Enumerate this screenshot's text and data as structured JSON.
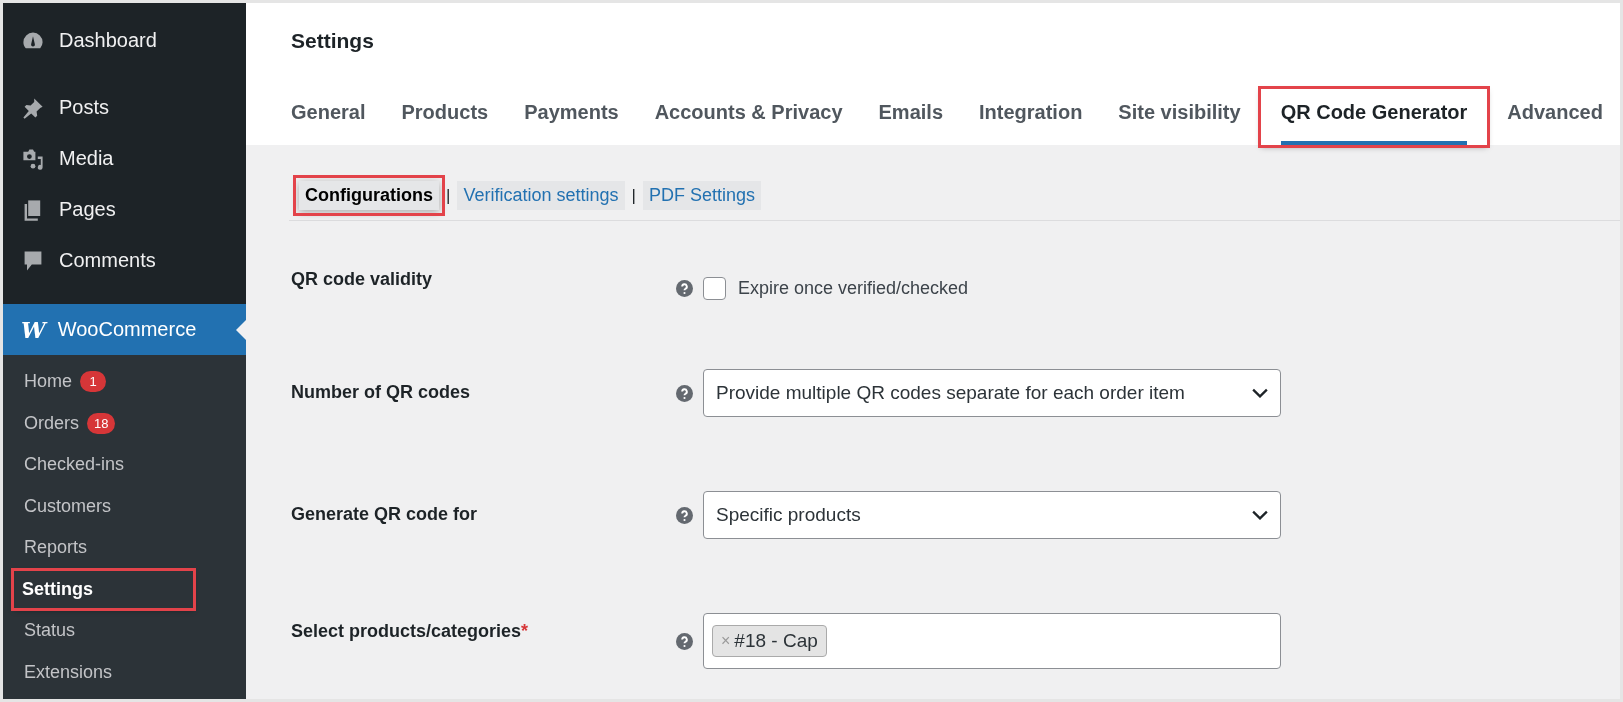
{
  "sidebar": {
    "top_items": [
      {
        "label": "Dashboard"
      },
      {
        "label": "Posts"
      },
      {
        "label": "Media"
      },
      {
        "label": "Pages"
      },
      {
        "label": "Comments"
      }
    ],
    "active_menu": {
      "label": "WooCommerce",
      "logo": "W"
    },
    "submenu": [
      {
        "label": "Home",
        "badge": "1",
        "selected": false,
        "highlighted": false
      },
      {
        "label": "Orders",
        "badge": "18",
        "selected": false,
        "highlighted": false
      },
      {
        "label": "Checked-ins",
        "selected": false,
        "highlighted": false
      },
      {
        "label": "Customers",
        "selected": false,
        "highlighted": false
      },
      {
        "label": "Reports",
        "selected": false,
        "highlighted": false
      },
      {
        "label": "Settings",
        "selected": true,
        "highlighted": true
      },
      {
        "label": "Status",
        "selected": false,
        "highlighted": false
      },
      {
        "label": "Extensions",
        "selected": false,
        "highlighted": false
      }
    ]
  },
  "page_title": "Settings",
  "tabs": [
    {
      "label": "General",
      "selected": false,
      "highlighted": false
    },
    {
      "label": "Products",
      "selected": false,
      "highlighted": false
    },
    {
      "label": "Payments",
      "selected": false,
      "highlighted": false
    },
    {
      "label": "Accounts & Privacy",
      "selected": false,
      "highlighted": false
    },
    {
      "label": "Emails",
      "selected": false,
      "highlighted": false
    },
    {
      "label": "Integration",
      "selected": false,
      "highlighted": false
    },
    {
      "label": "Site visibility",
      "selected": false,
      "highlighted": false
    },
    {
      "label": "QR Code Generator",
      "selected": true,
      "highlighted": true
    },
    {
      "label": "Advanced",
      "selected": false,
      "highlighted": false
    }
  ],
  "sub_tabs": [
    {
      "label": "Configurations",
      "selected": true,
      "highlighted": true
    },
    {
      "label": "Verification settings",
      "selected": false,
      "highlighted": false
    },
    {
      "label": "PDF Settings",
      "selected": false,
      "highlighted": false
    }
  ],
  "sub_tab_separator": "|",
  "form": [
    {
      "kind": "checkbox",
      "label": "QR code validity",
      "checked": false,
      "option": "Expire once verified/checked"
    },
    {
      "kind": "select",
      "label": "Number of QR codes",
      "value": "Provide multiple QR codes separate for each order item"
    },
    {
      "kind": "select",
      "label": "Generate QR code for",
      "value": "Specific products"
    },
    {
      "kind": "multiselect",
      "label": "Select products/categories",
      "required_mark": "*",
      "chips": [
        {
          "remove": "×",
          "label": "#18 - Cap"
        }
      ]
    }
  ]
}
